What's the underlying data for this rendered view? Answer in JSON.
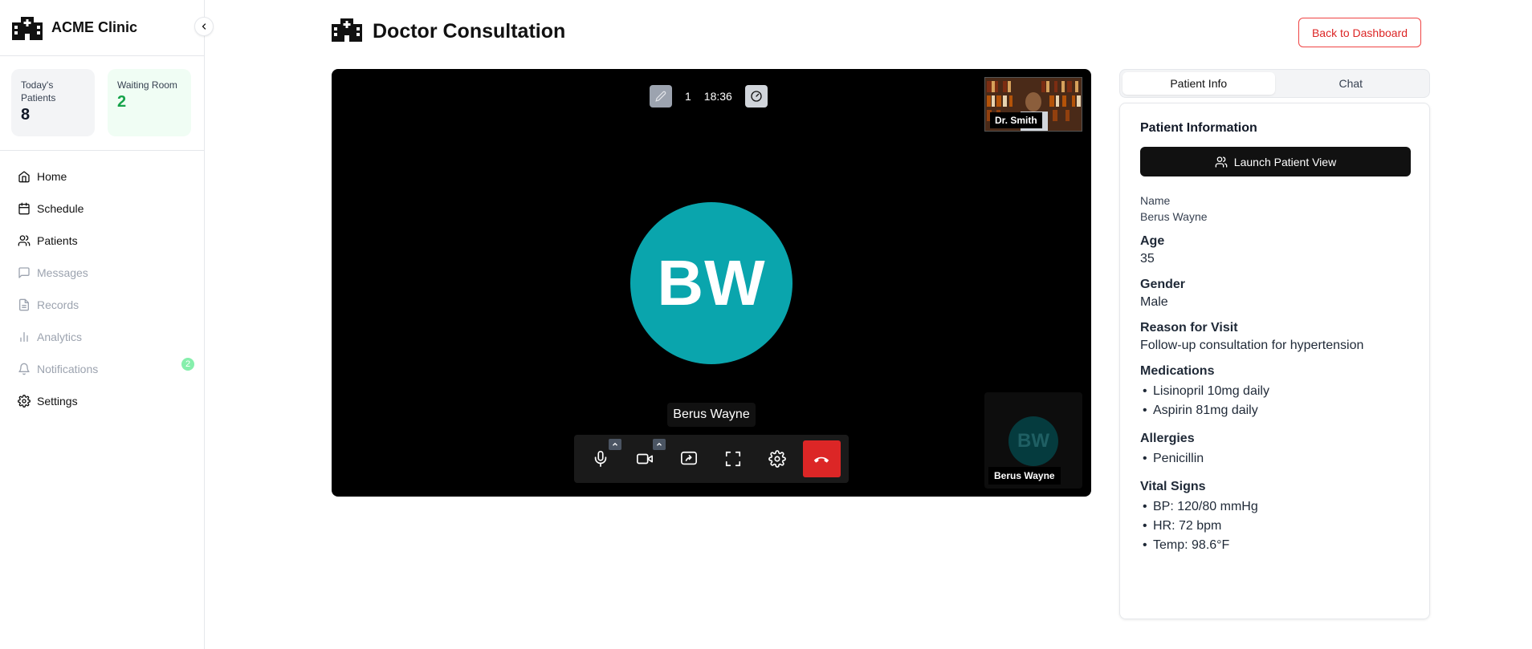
{
  "app": {
    "name": "ACME Clinic"
  },
  "stats": [
    {
      "label": "Today's Patients",
      "value": "8"
    },
    {
      "label": "Waiting Room",
      "value": "2"
    }
  ],
  "nav": [
    {
      "label": "Home",
      "icon": "home-icon",
      "enabled": true
    },
    {
      "label": "Schedule",
      "icon": "calendar-icon",
      "enabled": true
    },
    {
      "label": "Patients",
      "icon": "users-icon",
      "enabled": true
    },
    {
      "label": "Messages",
      "icon": "message-icon",
      "enabled": false
    },
    {
      "label": "Records",
      "icon": "file-icon",
      "enabled": false
    },
    {
      "label": "Analytics",
      "icon": "bar-chart-icon",
      "enabled": false
    },
    {
      "label": "Notifications",
      "icon": "bell-icon",
      "enabled": false,
      "badge": "2"
    },
    {
      "label": "Settings",
      "icon": "gear-icon",
      "enabled": true
    }
  ],
  "header": {
    "title": "Doctor Consultation",
    "back_label": "Back to Dashboard"
  },
  "video": {
    "participant_count": "1",
    "timer": "18:36",
    "main_initials": "BW",
    "main_name": "Berus Wayne",
    "self_label": "Dr. Smith",
    "pip_initials": "BW",
    "pip_name": "Berus Wayne"
  },
  "panel": {
    "tabs": [
      "Patient Info",
      "Chat"
    ],
    "title": "Patient Information",
    "launch_label": "Launch Patient View",
    "name_label": "Name",
    "name_value": "Berus Wayne",
    "age_label": "Age",
    "age_value": "35",
    "gender_label": "Gender",
    "gender_value": "Male",
    "reason_label": "Reason for Visit",
    "reason_value": "Follow-up consultation for hypertension",
    "medications_label": "Medications",
    "medications": [
      "Lisinopril 10mg daily",
      "Aspirin 81mg daily"
    ],
    "allergies_label": "Allergies",
    "allergies": [
      "Penicillin"
    ],
    "vitals_label": "Vital Signs",
    "vitals": [
      "BP: 120/80 mmHg",
      "HR: 72 bpm",
      "Temp: 98.6°F"
    ]
  },
  "colors": {
    "accent_red": "#dc2626",
    "avatar_teal": "#0aa5ad",
    "waiting_green": "#16a34a"
  }
}
